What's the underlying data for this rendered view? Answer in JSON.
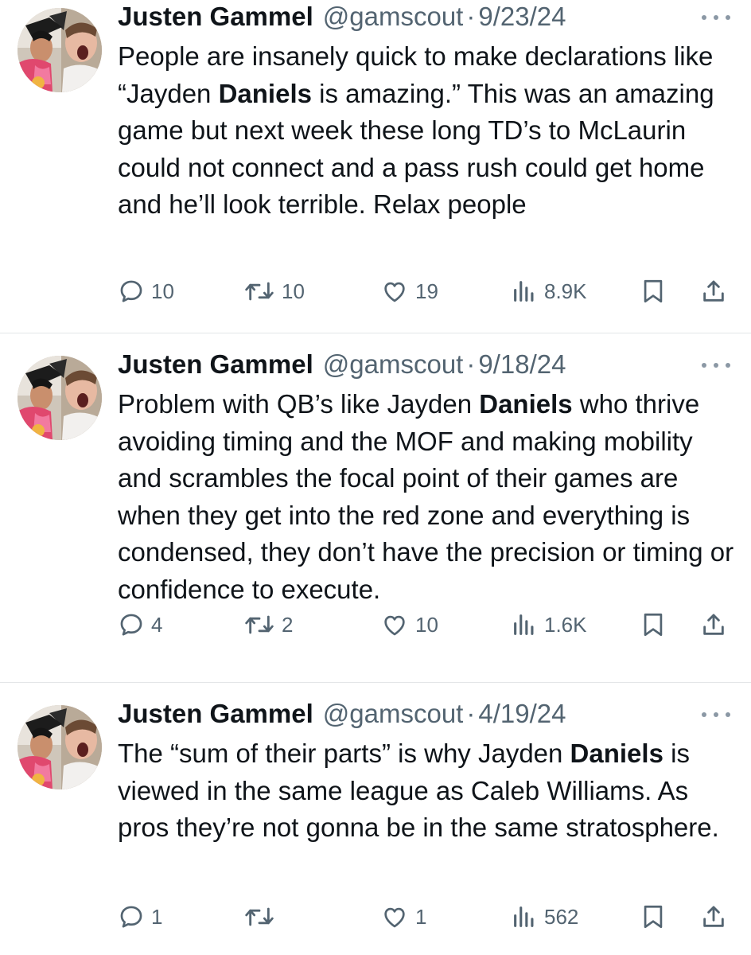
{
  "tweets": [
    {
      "name": "Justen Gammel",
      "handle": "@gamscout",
      "separator": "·",
      "date": "9/23/24",
      "text_html": "People are insanely quick to make declarations like “Jayden <b>Daniels</b> is amazing.” This was an amazing game but next week these long TD’s to McLaurin could not connect and a pass rush could get home and he’ll look terrible. Relax people",
      "text": "People are insanely quick to make declarations like “Jayden Daniels is amazing.” This was an amazing game but next week these long TD’s to McLaurin could not connect and a pass rush could get home and he’ll look terrible. Relax people",
      "replies": "10",
      "retweets": "10",
      "likes": "19",
      "views": "8.9K"
    },
    {
      "name": "Justen Gammel",
      "handle": "@gamscout",
      "separator": "·",
      "date": "9/18/24",
      "text_html": "Problem with QB’s like Jayden <b>Daniels</b> who thrive avoiding timing and the MOF and making mobility and scrambles the focal point of their games are when they get into the red zone and everything is condensed, they don’t have the precision or timing or confidence to execute.",
      "text": "Problem with QB’s like Jayden Daniels who thrive avoiding timing and the MOF and making mobility and scrambles the focal point of their games are when they get into the red zone and everything is condensed, they don’t have the precision or timing or confidence to execute.",
      "replies": "4",
      "retweets": "2",
      "likes": "10",
      "views": "1.6K"
    },
    {
      "name": "Justen Gammel",
      "handle": "@gamscout",
      "separator": "·",
      "date": "4/19/24",
      "text_html": "The “sum of their parts” is why Jayden <b>Daniels</b> is viewed in the same league as Caleb Williams. As pros they’re not gonna be in the same stratosphere.",
      "text": "The “sum of their parts” is why Jayden Daniels is viewed in the same league as Caleb Williams. As pros they’re not gonna be in the same stratosphere.",
      "replies": "1",
      "retweets": "",
      "likes": "1",
      "views": "562"
    }
  ],
  "icons": {
    "reply": "reply-icon",
    "retweet": "retweet-icon",
    "like": "like-icon",
    "views": "views-icon",
    "bookmark": "bookmark-icon",
    "share": "share-icon",
    "more": "more-icon"
  },
  "colors": {
    "text": "#0f1419",
    "secondary": "#536471",
    "divider": "#e3e6e8"
  }
}
